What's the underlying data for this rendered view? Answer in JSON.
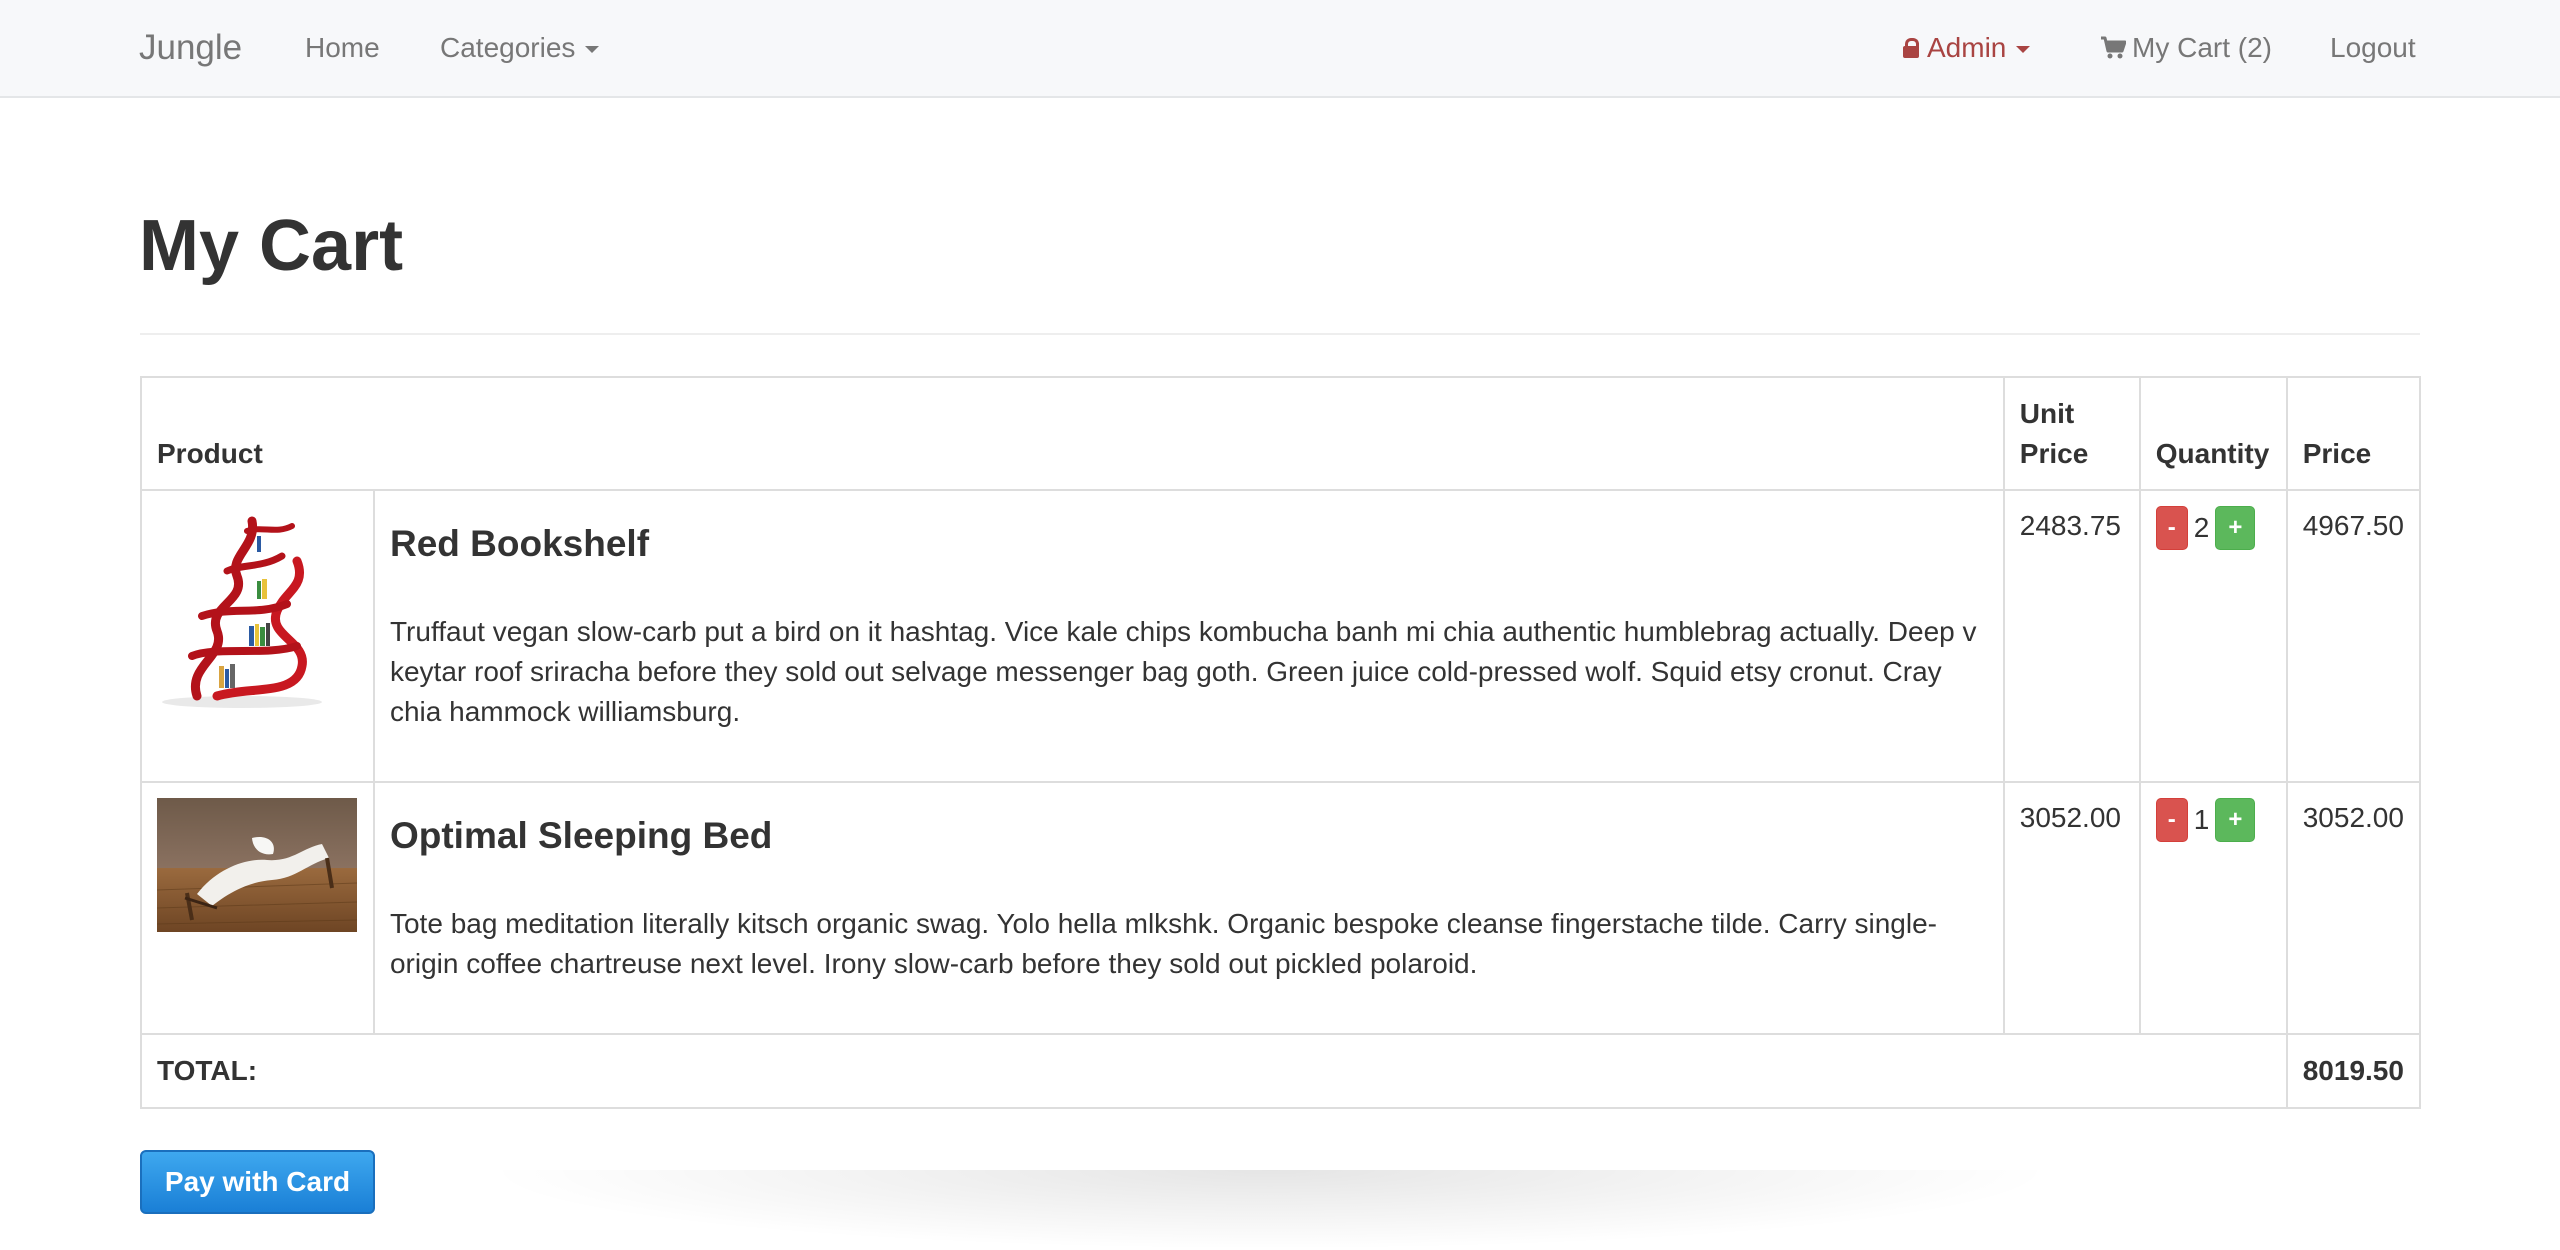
{
  "navbar": {
    "brand": "Jungle",
    "home": "Home",
    "categories": "Categories",
    "admin": "Admin",
    "cart": "My Cart (2)",
    "logout": "Logout"
  },
  "page": {
    "title": "My Cart"
  },
  "table": {
    "headers": {
      "product": "Product",
      "unit_price": "Unit Price",
      "quantity": "Quantity",
      "price": "Price"
    },
    "rows": [
      {
        "name": "Red Bookshelf",
        "description": "Truffaut vegan slow-carb put a bird on it hashtag. Vice kale chips kombucha banh mi chia authentic humblebrag actually. Deep v keytar roof sriracha before they sold out selvage messenger bag goth. Green juice cold-pressed wolf. Squid etsy cronut. Cray chia hammock williamsburg.",
        "unit_price": "2483.75",
        "quantity": "2",
        "price": "4967.50"
      },
      {
        "name": "Optimal Sleeping Bed",
        "description": "Tote bag meditation literally kitsch organic swag. Yolo hella mlkshk. Organic bespoke cleanse fingerstache tilde. Carry single-origin coffee chartreuse next level. Irony slow-carb before they sold out pickled polaroid.",
        "unit_price": "3052.00",
        "quantity": "1",
        "price": "3052.00"
      }
    ],
    "qty_minus": "-",
    "qty_plus": "+",
    "total_label": "TOTAL:",
    "total_value": "8019.50"
  },
  "pay_button": "Pay with Card",
  "colors": {
    "admin": "#a94442",
    "minus": "#d9534f",
    "plus": "#5cb85c",
    "pay": "#1a7fd6"
  }
}
